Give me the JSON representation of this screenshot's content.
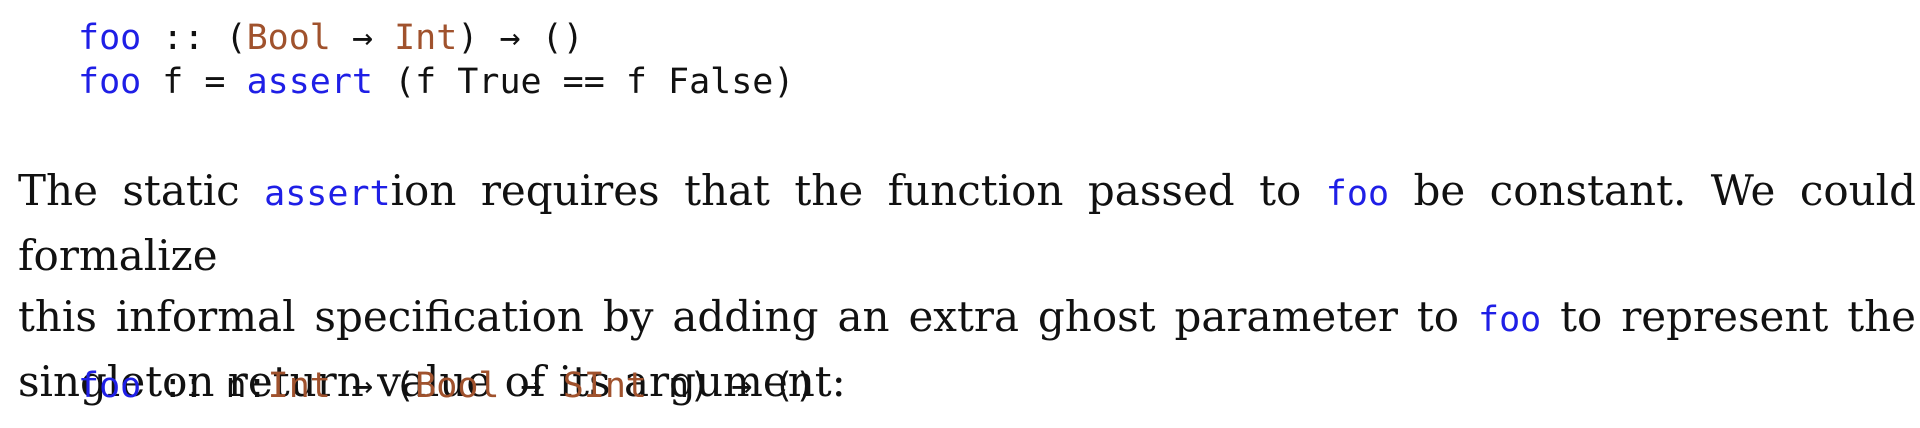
{
  "code_block_1": {
    "line_1": {
      "fn": "foo",
      "sep": " :: (",
      "t1": "Bool",
      "arr1": " → ",
      "t2": "Int",
      "rest": ") → ()"
    },
    "line_2": {
      "fn": "foo",
      "mid": " f = ",
      "assert": "assert",
      "rest": " (f True == f False)"
    }
  },
  "paragraph": {
    "l1_a": "The static ",
    "l1_code": "assert",
    "l1_b": "ion requires that the function passed to ",
    "l1_code2": "foo",
    "l1_c": " be constant. We could formalize",
    "l2_a": "this informal specification by adding an extra ghost parameter to ",
    "l2_code": "foo",
    "l2_b": " to represent the",
    "l3": "singleton return value of its argument:"
  },
  "code_block_2": {
    "fn": "foo",
    "sep": " :: n:",
    "t1": "Int",
    "arr1": " → (",
    "t2": "Bool",
    "arr2": " → ",
    "t3": "SInt",
    "rest": " n) → ()"
  },
  "colors": {
    "keyword": "#1f1fe6",
    "type": "#a0522d",
    "text": "#111111"
  }
}
